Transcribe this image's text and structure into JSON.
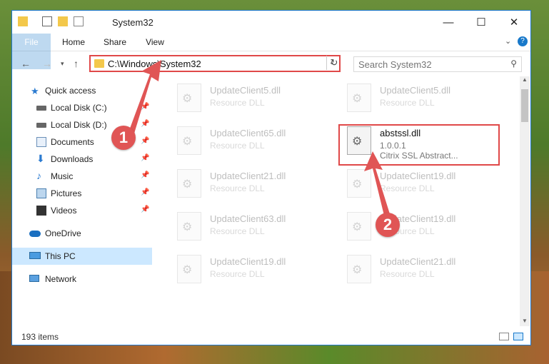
{
  "window": {
    "title": "System32"
  },
  "ribbon": {
    "tabs": [
      "File",
      "Home",
      "Share",
      "View"
    ]
  },
  "address": {
    "path": "C:\\Windows\\System32"
  },
  "search": {
    "placeholder": "Search System32"
  },
  "sidebar": {
    "items": [
      {
        "label": "Quick access"
      },
      {
        "label": "Local Disk (C:)"
      },
      {
        "label": "Local Disk (D:)"
      },
      {
        "label": "Documents"
      },
      {
        "label": "Downloads"
      },
      {
        "label": "Music"
      },
      {
        "label": "Pictures"
      },
      {
        "label": "Videos"
      },
      {
        "label": "OneDrive"
      },
      {
        "label": "This PC"
      },
      {
        "label": "Network"
      }
    ]
  },
  "files": {
    "col1": [
      {
        "name": "UpdateClient5.dll",
        "type": "Resource DLL"
      },
      {
        "name": "UpdateClient65.dll",
        "type": "Resource DLL"
      },
      {
        "name": "UpdateClient21.dll",
        "type": "Resource DLL"
      },
      {
        "name": "UpdateClient63.dll",
        "type": "Resource DLL"
      },
      {
        "name": "UpdateClient19.dll",
        "type": "Resource DLL"
      }
    ],
    "col2": [
      {
        "name": "UpdateClient5.dll",
        "type": "Resource DLL"
      },
      {
        "name": "abstssl.dll",
        "version": "1.0.0.1",
        "desc": "Citrix SSL Abstract..."
      },
      {
        "name": "UpdateClient19.dll",
        "type": "Resource DLL"
      },
      {
        "name": "UpdateClient19.dll",
        "type": "Resource DLL"
      },
      {
        "name": "UpdateClient21.dll",
        "type": "Resource DLL"
      }
    ]
  },
  "status": {
    "count": "193 items"
  },
  "annotations": {
    "step1": "1",
    "step2": "2"
  },
  "colors": {
    "accent": "#1979ca",
    "highlight": "#e04848"
  }
}
